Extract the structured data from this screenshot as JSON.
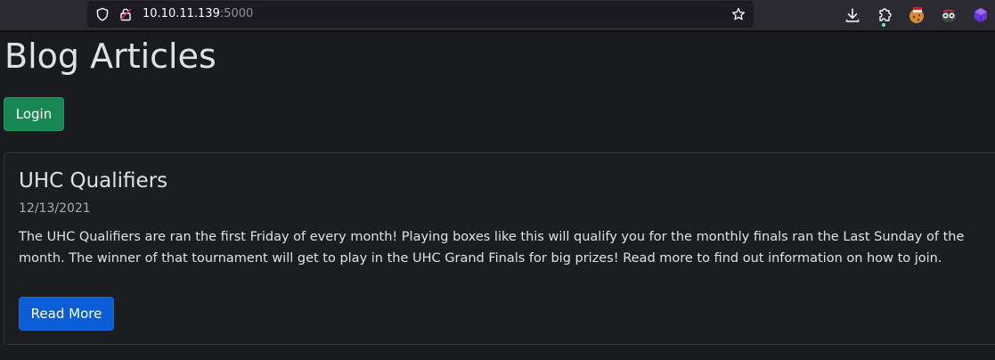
{
  "browser": {
    "url_host": "10.10.11.139",
    "url_port": ":5000"
  },
  "page": {
    "title": "Blog Articles",
    "login_label": "Login"
  },
  "articles": [
    {
      "title": "UHC Qualifiers",
      "date": "12/13/2021",
      "body": "The UHC Qualifiers are ran the first Friday of every month! Playing boxes like this will qualify you for the monthly finals ran the Last Sunday of the month. The winner of that tournament will get to play in the UHC Grand Finals for big prizes! Read more to find out information on how to join.",
      "read_more_label": "Read More"
    }
  ],
  "icons": {
    "url_bar": [
      "shield-icon",
      "lock-icon",
      "bookmark-star-icon"
    ],
    "toolbar": [
      "download-icon",
      "extensions-icon",
      "cookie-extension-icon",
      "user-agent-extension-icon",
      "purple-cube-extension-icon"
    ]
  },
  "colors": {
    "page_background": "#1a1b1e",
    "login_button": "#198754",
    "read_more_button": "#0b5ed7",
    "text": "#dee2e6",
    "date_text": "#a7acb1"
  }
}
